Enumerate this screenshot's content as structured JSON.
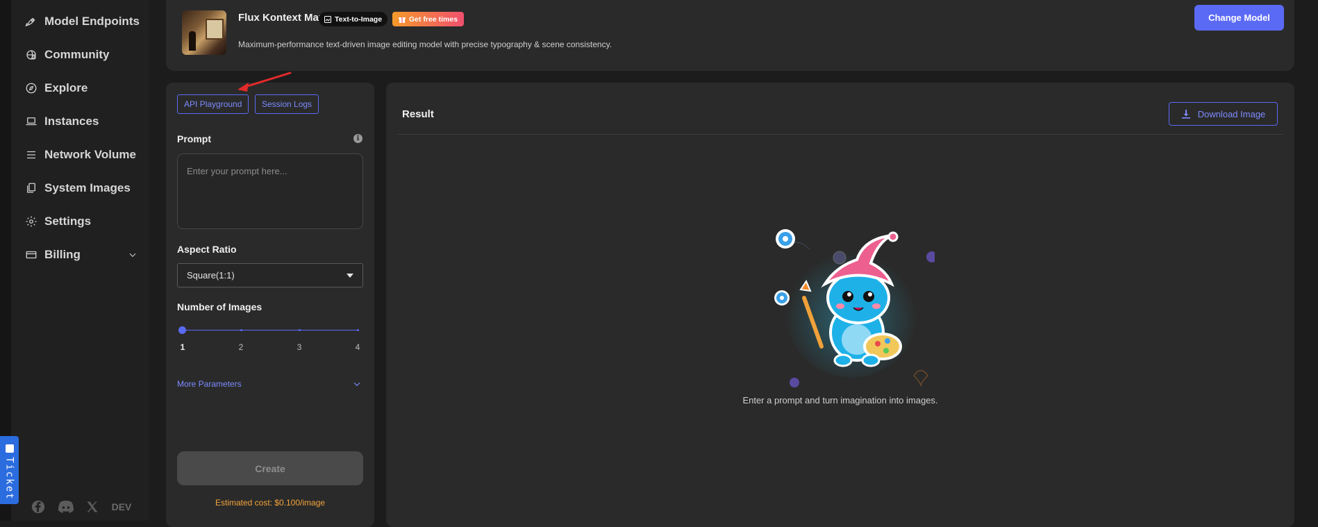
{
  "sidebar": {
    "items": [
      {
        "label": "Model Endpoints",
        "icon": "rocket-icon"
      },
      {
        "label": "Community",
        "icon": "community-icon"
      },
      {
        "label": "Explore",
        "icon": "compass-icon"
      },
      {
        "label": "Instances",
        "icon": "laptop-icon"
      },
      {
        "label": "Network Volume",
        "icon": "list-icon"
      },
      {
        "label": "System Images",
        "icon": "copy-icon"
      },
      {
        "label": "Settings",
        "icon": "gear-icon"
      },
      {
        "label": "Billing",
        "icon": "card-icon"
      }
    ],
    "footer": {
      "dev_label": "DEV"
    }
  },
  "ticket": {
    "label": "Ticket"
  },
  "model": {
    "title": "Flux Kontext Max",
    "type_badge": "Text-to-Image",
    "promo_badge": "Get free times",
    "description": "Maximum-performance text-driven image editing model with precise typography & scene consistency.",
    "change_label": "Change Model"
  },
  "left_panel": {
    "tabs": [
      "API Playground",
      "Session Logs"
    ],
    "prompt_label": "Prompt",
    "prompt_placeholder": "Enter your prompt here...",
    "prompt_value": "",
    "aspect_label": "Aspect Ratio",
    "aspect_value": "Square(1:1)",
    "images_label": "Number of Images",
    "images_options": [
      "1",
      "2",
      "3",
      "4"
    ],
    "images_selected": "1",
    "more_params_label": "More Parameters",
    "create_label": "Create",
    "estimated_cost": "Estimated cost: $0.100/image"
  },
  "result": {
    "title": "Result",
    "download_label": "Download Image",
    "empty_text": "Enter a prompt and turn imagination into images."
  },
  "colors": {
    "accent": "#5b6af5",
    "accent_text": "#7d8bff",
    "cost": "#f4a53a",
    "arrow": "#e32a2a",
    "promo_start": "#f59a2b",
    "promo_end": "#f0506e",
    "ticket": "#2b6cdf"
  }
}
